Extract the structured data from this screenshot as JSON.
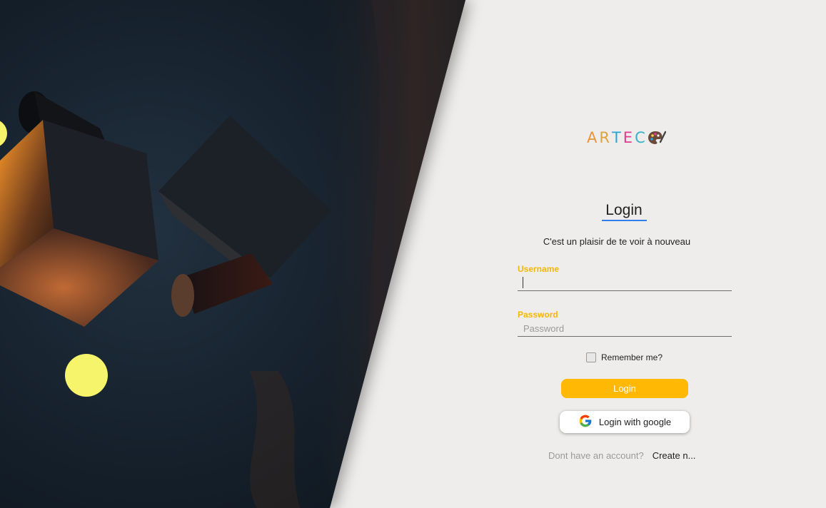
{
  "app": {
    "logo_text": [
      "A",
      "R",
      "T",
      "E",
      "C"
    ],
    "logo_colors": [
      "#e8963a",
      "#e0a23b",
      "#2aa4d8",
      "#e23d8f",
      "#3bb0c9"
    ]
  },
  "login": {
    "title": "Login",
    "subtitle": "C'est un plaisir de te voir à nouveau",
    "username_label": "Username",
    "username_value": "",
    "password_label": "Password",
    "password_placeholder": "Password",
    "remember_label": "Remember me?",
    "remember_checked": false,
    "login_button": "Login",
    "google_button": "Login with google",
    "no_account_text": "Dont have an account?",
    "create_link": "Create n..."
  },
  "colors": {
    "accent": "#ffb905",
    "label": "#f5b700",
    "title_underline": "#2f80ed",
    "background": "#eeedeb"
  },
  "icons": [
    "palette-icon",
    "google-icon"
  ]
}
